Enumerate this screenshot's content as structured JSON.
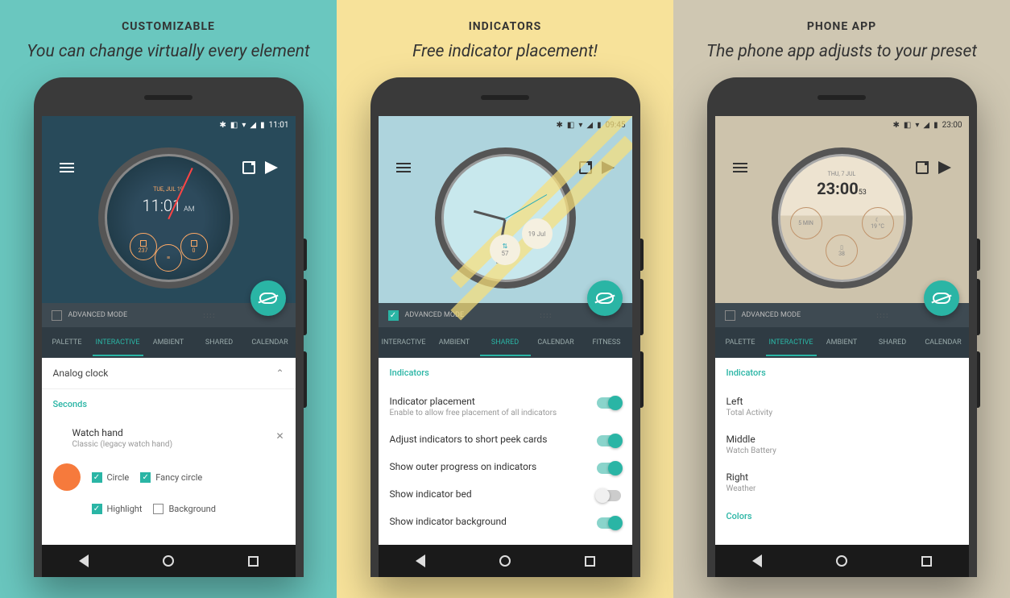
{
  "panels": [
    {
      "title": "CUSTOMIZABLE",
      "sub": "You can change virtually every element",
      "bg": "#6ac7bf"
    },
    {
      "title": "INDICATORS",
      "sub": "Free indicator placement!",
      "bg": "#f7e29a"
    },
    {
      "title": "PHONE APP",
      "sub": "The phone app adjusts to your preset",
      "bg": "#cfc7b2"
    }
  ],
  "status_times": [
    "11:01",
    "09:45",
    "23:00"
  ],
  "adv_label": "ADVANCED MODE",
  "tabs1": [
    "PALETTE",
    "INTERACTIVE",
    "AMBIENT",
    "SHARED",
    "CALENDAR"
  ],
  "tabs2": [
    "INTERACTIVE",
    "AMBIENT",
    "SHARED",
    "CALENDAR",
    "FITNESS"
  ],
  "tabs3": [
    "PALETTE",
    "INTERACTIVE",
    "AMBIENT",
    "SHARED",
    "CALENDAR"
  ],
  "s1": {
    "exp": "Analog clock",
    "section": "Seconds",
    "item_title": "Watch hand",
    "item_sub": "Classic (legacy watch hand)",
    "cb": [
      "Circle",
      "Fancy circle",
      "Highlight",
      "Background"
    ]
  },
  "s2": {
    "section": "Indicators",
    "rows": [
      {
        "t": "Indicator placement",
        "s": "Enable to allow free placement of all indicators",
        "on": true
      },
      {
        "t": "Adjust indicators to short peek cards",
        "on": true
      },
      {
        "t": "Show outer progress on indicators",
        "on": true
      },
      {
        "t": "Show indicator bed",
        "on": false
      },
      {
        "t": "Show indicator background",
        "on": true
      }
    ]
  },
  "s3": {
    "section": "Indicators",
    "rows": [
      {
        "t": "Left",
        "s": "Total Activity"
      },
      {
        "t": "Middle",
        "s": "Watch Battery"
      },
      {
        "t": "Right",
        "s": "Weather"
      }
    ],
    "section2": "Colors"
  },
  "w1": {
    "time": "11:01",
    "ampm": "AM",
    "date": "TUE, JUL 19",
    "d1": "237",
    "d2": "0"
  },
  "w2": {
    "steps": "57",
    "date": "19 Jul"
  },
  "w3": {
    "date": "THU, 7 JUL",
    "time": "23:00",
    "sec": "53",
    "l": "5 MIN",
    "r": "19 °C",
    "m": "38"
  }
}
